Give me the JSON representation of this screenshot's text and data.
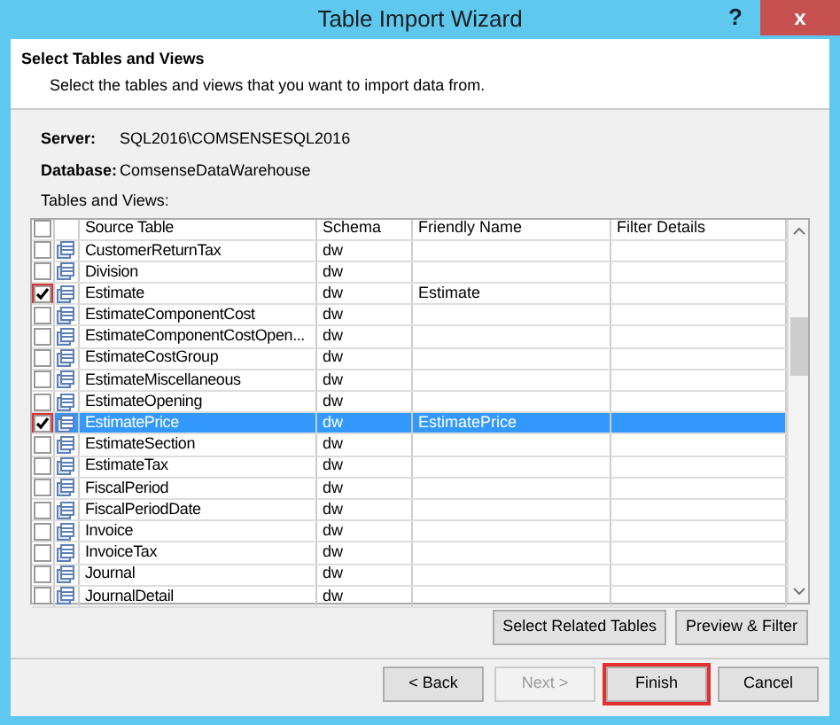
{
  "window": {
    "title": "Table Import Wizard",
    "help_button": "?",
    "close_button": "x"
  },
  "header": {
    "title": "Select Tables and Views",
    "subtitle": "Select the tables and views that you want to import data from."
  },
  "server": {
    "label": "Server:",
    "value": "SQL2016\\COMSENSESQL2016"
  },
  "database": {
    "label": "Database:",
    "value": "ComsenseDataWarehouse"
  },
  "list_label": "Tables and Views:",
  "table": {
    "select_all_checked": false,
    "columns": [
      "Source Table",
      "Schema",
      "Friendly Name",
      "Filter Details"
    ],
    "rows": [
      {
        "source": "CustomerReturnTax",
        "schema": "dw",
        "friendly": "",
        "checked": false,
        "selected": false,
        "highlighted": false
      },
      {
        "source": "Division",
        "schema": "dw",
        "friendly": "",
        "checked": false,
        "selected": false,
        "highlighted": false
      },
      {
        "source": "Estimate",
        "schema": "dw",
        "friendly": "Estimate",
        "checked": true,
        "selected": false,
        "highlighted": true
      },
      {
        "source": "EstimateComponentCost",
        "schema": "dw",
        "friendly": "",
        "checked": false,
        "selected": false,
        "highlighted": false
      },
      {
        "source": "EstimateComponentCostOpen...",
        "schema": "dw",
        "friendly": "",
        "checked": false,
        "selected": false,
        "highlighted": false
      },
      {
        "source": "EstimateCostGroup",
        "schema": "dw",
        "friendly": "",
        "checked": false,
        "selected": false,
        "highlighted": false
      },
      {
        "source": "EstimateMiscellaneous",
        "schema": "dw",
        "friendly": "",
        "checked": false,
        "selected": false,
        "highlighted": false
      },
      {
        "source": "EstimateOpening",
        "schema": "dw",
        "friendly": "",
        "checked": false,
        "selected": false,
        "highlighted": false
      },
      {
        "source": "EstimatePrice",
        "schema": "dw",
        "friendly": "EstimatePrice",
        "checked": true,
        "selected": true,
        "highlighted": true
      },
      {
        "source": "EstimateSection",
        "schema": "dw",
        "friendly": "",
        "checked": false,
        "selected": false,
        "highlighted": false
      },
      {
        "source": "EstimateTax",
        "schema": "dw",
        "friendly": "",
        "checked": false,
        "selected": false,
        "highlighted": false
      },
      {
        "source": "FiscalPeriod",
        "schema": "dw",
        "friendly": "",
        "checked": false,
        "selected": false,
        "highlighted": false
      },
      {
        "source": "FiscalPeriodDate",
        "schema": "dw",
        "friendly": "",
        "checked": false,
        "selected": false,
        "highlighted": false
      },
      {
        "source": "Invoice",
        "schema": "dw",
        "friendly": "",
        "checked": false,
        "selected": false,
        "highlighted": false
      },
      {
        "source": "InvoiceTax",
        "schema": "dw",
        "friendly": "",
        "checked": false,
        "selected": false,
        "highlighted": false
      },
      {
        "source": "Journal",
        "schema": "dw",
        "friendly": "",
        "checked": false,
        "selected": false,
        "highlighted": false
      },
      {
        "source": "JournalDetail",
        "schema": "dw",
        "friendly": "",
        "checked": false,
        "selected": false,
        "highlighted": false
      }
    ]
  },
  "action_buttons": [
    "Select Related Tables",
    "Preview & Filter"
  ],
  "nav_buttons": [
    {
      "label": "< Back",
      "disabled": false,
      "highlighted": false
    },
    {
      "label": "Next >",
      "disabled": true,
      "highlighted": false
    },
    {
      "label": "Finish",
      "disabled": false,
      "highlighted": true
    },
    {
      "label": "Cancel",
      "disabled": false,
      "highlighted": false
    }
  ]
}
